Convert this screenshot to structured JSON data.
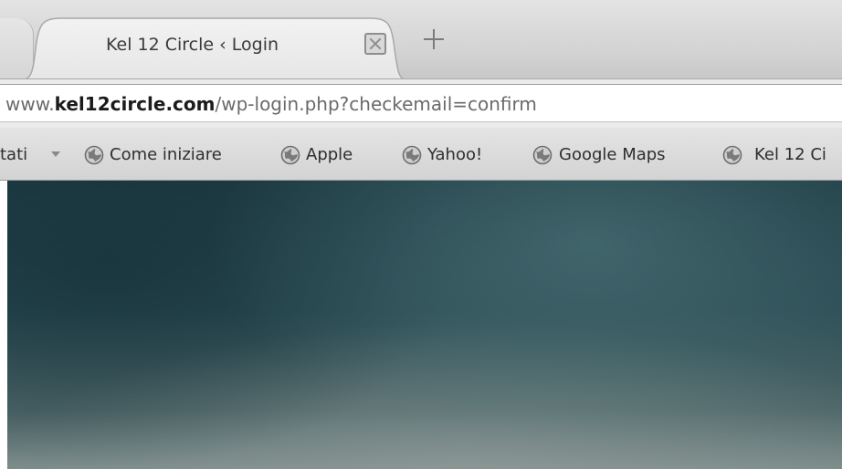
{
  "tabs": [
    {
      "title": "Kel 12 Circle ‹ Login",
      "active": true
    }
  ],
  "tab_controls": {
    "close_icon": "close-box-icon",
    "new_tab_icon": "plus-icon"
  },
  "address_bar": {
    "url_prefix": "www.",
    "url_domain": "kel12circle.com",
    "url_path": "/wp-login.php?checkemail=confirm"
  },
  "bookmarks_bar": {
    "items": [
      {
        "label": "tati",
        "icon": "chevron-down-icon"
      },
      {
        "label": "Come iniziare",
        "icon": "globe-icon"
      },
      {
        "label": "Apple",
        "icon": "globe-icon"
      },
      {
        "label": "Yahoo!",
        "icon": "globe-icon"
      },
      {
        "label": "Google Maps",
        "icon": "globe-icon"
      },
      {
        "label": "Kel 12 Ci",
        "icon": "globe-icon"
      }
    ]
  },
  "colors": {
    "page_background_dark": "#1f3c45",
    "page_background_light": "#7d8c8b",
    "chrome_gray": "#d2d2d2"
  }
}
